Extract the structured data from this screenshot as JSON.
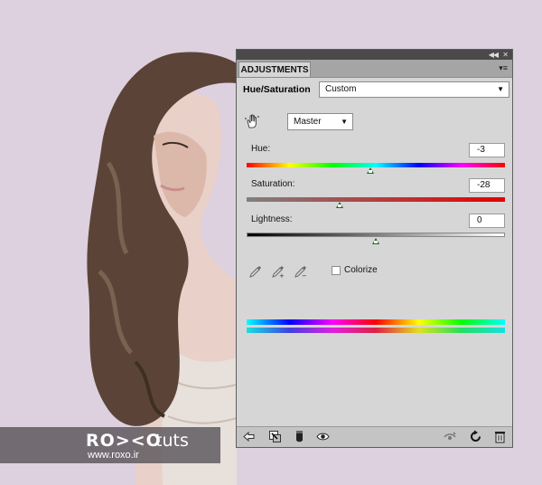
{
  "watermark": {
    "logo": "RO><O",
    "suffix": "tuts",
    "url": "www.roxo.ir"
  },
  "panel": {
    "tab_label": "ADJUSTMENTS",
    "title": "Hue/Saturation",
    "preset": "Custom",
    "channel": "Master",
    "sliders": [
      {
        "label": "Hue:",
        "value": "-3",
        "position": 0.48
      },
      {
        "label": "Saturation:",
        "value": "-28",
        "position": 0.36
      },
      {
        "label": "Lightness:",
        "value": "0",
        "position": 0.5
      }
    ],
    "colorize_label": "Colorize",
    "colorize_checked": false
  },
  "colors": {
    "panel_bg": "#d6d6d6",
    "thumb": "#1b6b1b",
    "page_bg": "#ddd0df"
  },
  "icons": [
    "hand-target-icon",
    "eyedropper-icon",
    "eyedropper-plus-icon",
    "eyedropper-minus-icon",
    "back-arrow-icon",
    "clip-to-layer-icon",
    "layer-mask-icon",
    "visibility-eye-icon",
    "view-previous-icon",
    "reset-icon",
    "trash-icon"
  ]
}
